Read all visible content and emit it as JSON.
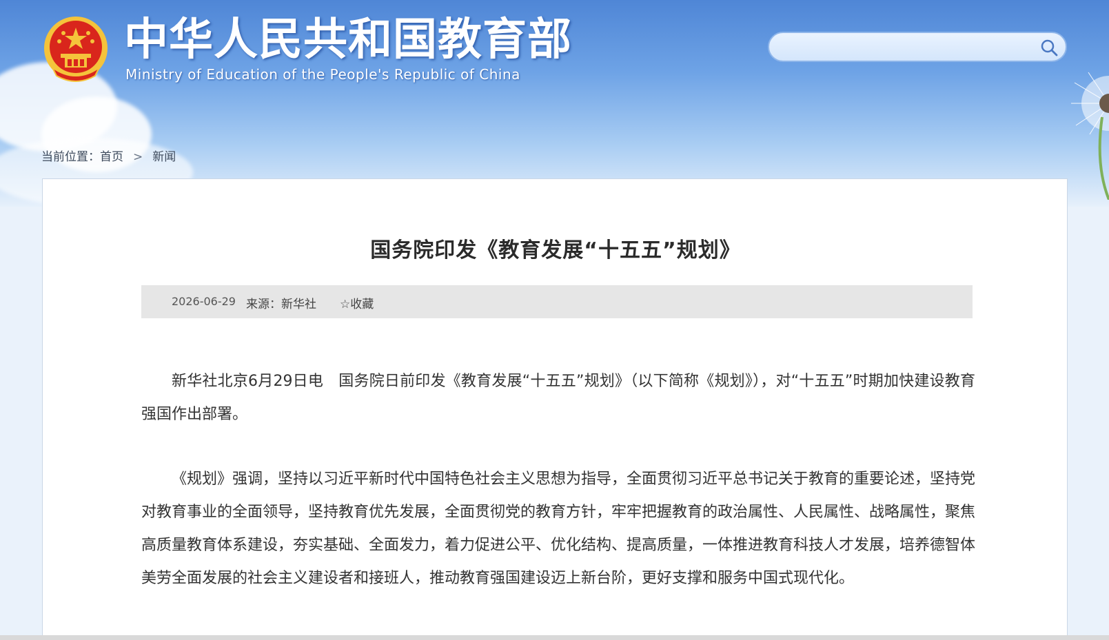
{
  "header": {
    "title": "中华人民共和国教育部",
    "subtitle": "Ministry of Education of the People's Republic of China",
    "search_placeholder": ""
  },
  "breadcrumb": {
    "prefix": "当前位置：",
    "items": [
      "首页",
      "新闻"
    ],
    "separator": ">"
  },
  "article": {
    "title": "国务院印发《教育发展“十五五”规划》",
    "date": "2026-06-29",
    "source": "来源：新华社",
    "favorite_label": "收藏",
    "paragraphs": [
      "新华社北京6月29日电　国务院日前印发《教育发展“十五五”规划》（以下简称《规划》），对“十五五”时期加快建设教育强国作出部署。",
      "《规划》强调，坚持以习近平新时代中国特色社会主义思想为指导，全面贯彻习近平总书记关于教育的重要论述，坚持党对教育事业的全面领导，坚持教育优先发展，全面贯彻党的教育方针，牢牢把握教育的政治属性、人民属性、战略属性，聚焦高质量教育体系建设，夯实基础、全面发力，着力促进公平、优化结构、提高质量，一体推进教育科技人才发展，培养德智体美劳全面发展的社会主义建设者和接班人，推动教育强国建设迈上新台阶，更好支撑和服务中国式现代化。"
    ]
  },
  "icons": {
    "emblem": "national-emblem-icon",
    "search": "search-icon",
    "favorite": "star-outline-icon",
    "separator": "chevron-right-icon"
  },
  "colors": {
    "header_blue": "#4f86d6",
    "title_text": "#2b2b2b",
    "meta_bg": "#e6e6e6",
    "emblem_red": "#d9261c",
    "emblem_gold": "#f5c33b"
  }
}
